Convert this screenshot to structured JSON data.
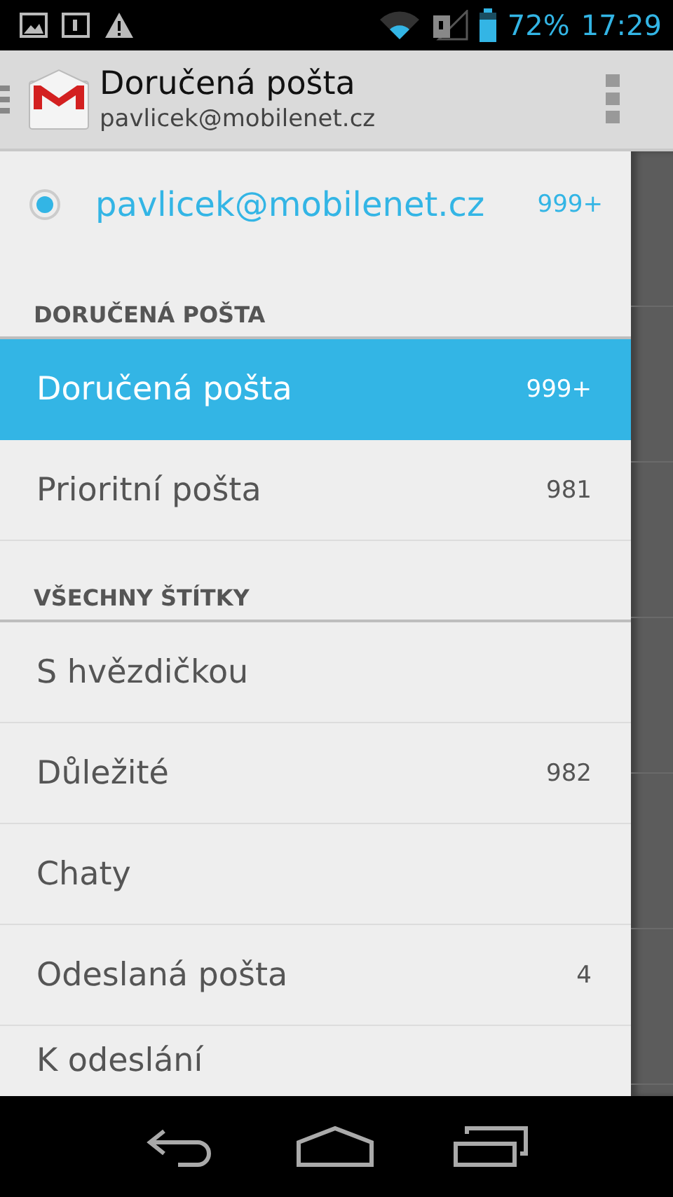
{
  "status_bar": {
    "battery": "72%",
    "time": "17:29"
  },
  "action_bar": {
    "title": "Doručená pošta",
    "subtitle": "pavlicek@mobilenet.cz"
  },
  "account": {
    "email": "pavlicek@mobilenet.cz",
    "count": "999+",
    "selected": true
  },
  "sections": [
    {
      "heading": "DORUČENÁ POŠTA",
      "items": [
        {
          "label": "Doručená pošta",
          "count": "999+",
          "selected": true
        },
        {
          "label": "Prioritní pošta",
          "count": "981",
          "selected": false
        }
      ]
    },
    {
      "heading": "VŠECHNY ŠTÍTKY",
      "items": [
        {
          "label": "S hvězdičkou",
          "selected": false
        },
        {
          "label": "Důležité",
          "count": "982",
          "selected": false
        },
        {
          "label": "Chaty",
          "selected": false
        },
        {
          "label": "Odeslaná pošta",
          "count": "4",
          "selected": false
        },
        {
          "label": "K odeslání",
          "selected": false
        }
      ]
    }
  ]
}
